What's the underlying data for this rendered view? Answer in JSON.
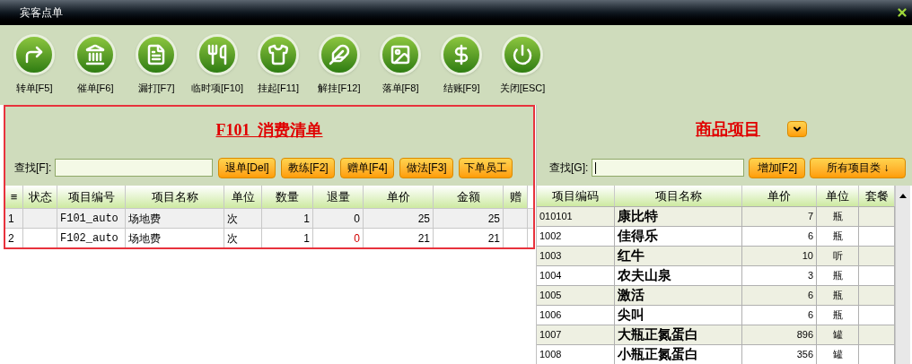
{
  "window": {
    "title": "宾客点单"
  },
  "toolbar": [
    {
      "label": "转单[F5]"
    },
    {
      "label": "催单[F6]"
    },
    {
      "label": "漏打[F7]"
    },
    {
      "label": "临时项[F10]"
    },
    {
      "label": "挂起[F11]"
    },
    {
      "label": "解挂[F12]"
    },
    {
      "label": "落单[F8]"
    },
    {
      "label": "结账[F9]"
    },
    {
      "label": "关闭[ESC]"
    }
  ],
  "bill": {
    "title": "F101  消费清单",
    "search_label": "查找[F]:",
    "search_focused": false,
    "buttons": [
      "退单[Del]",
      "教练[F2]",
      "赠单[F4]",
      "做法[F3]",
      "下单员工"
    ],
    "columns": [
      "≡",
      "状态",
      "项目编号",
      "项目名称",
      "单位",
      "数量",
      "退量",
      "单价",
      "金额",
      "赠"
    ],
    "rows": [
      {
        "cells": [
          "1",
          "",
          "F101_auto",
          "场地费",
          "次",
          "1",
          "0",
          "25",
          "25",
          ""
        ],
        "return_alert": false
      },
      {
        "cells": [
          "2",
          "",
          "F102_auto",
          "场地费",
          "次",
          "1",
          "0",
          "21",
          "21",
          ""
        ],
        "return_alert": true
      }
    ]
  },
  "products": {
    "title": "商品项目",
    "search_label": "查找[G]:",
    "search_focused": true,
    "buttons": [
      "增加[F2]",
      "所有项目类 ↓"
    ],
    "columns": [
      "项目编码",
      "项目名称",
      "单价",
      "单位",
      "套餐"
    ],
    "rows": [
      [
        "010101",
        "康比特",
        "7",
        "瓶",
        ""
      ],
      [
        "1002",
        "佳得乐",
        "6",
        "瓶",
        ""
      ],
      [
        "1003",
        "红牛",
        "10",
        "听",
        ""
      ],
      [
        "1004",
        "农夫山泉",
        "3",
        "瓶",
        ""
      ],
      [
        "1005",
        "激活",
        "6",
        "瓶",
        ""
      ],
      [
        "1006",
        "尖叫",
        "6",
        "瓶",
        ""
      ],
      [
        "1007",
        "大瓶正氮蛋白",
        "896",
        "罐",
        ""
      ],
      [
        "1008",
        "小瓶正氮蛋白",
        "356",
        "罐",
        ""
      ]
    ]
  }
}
